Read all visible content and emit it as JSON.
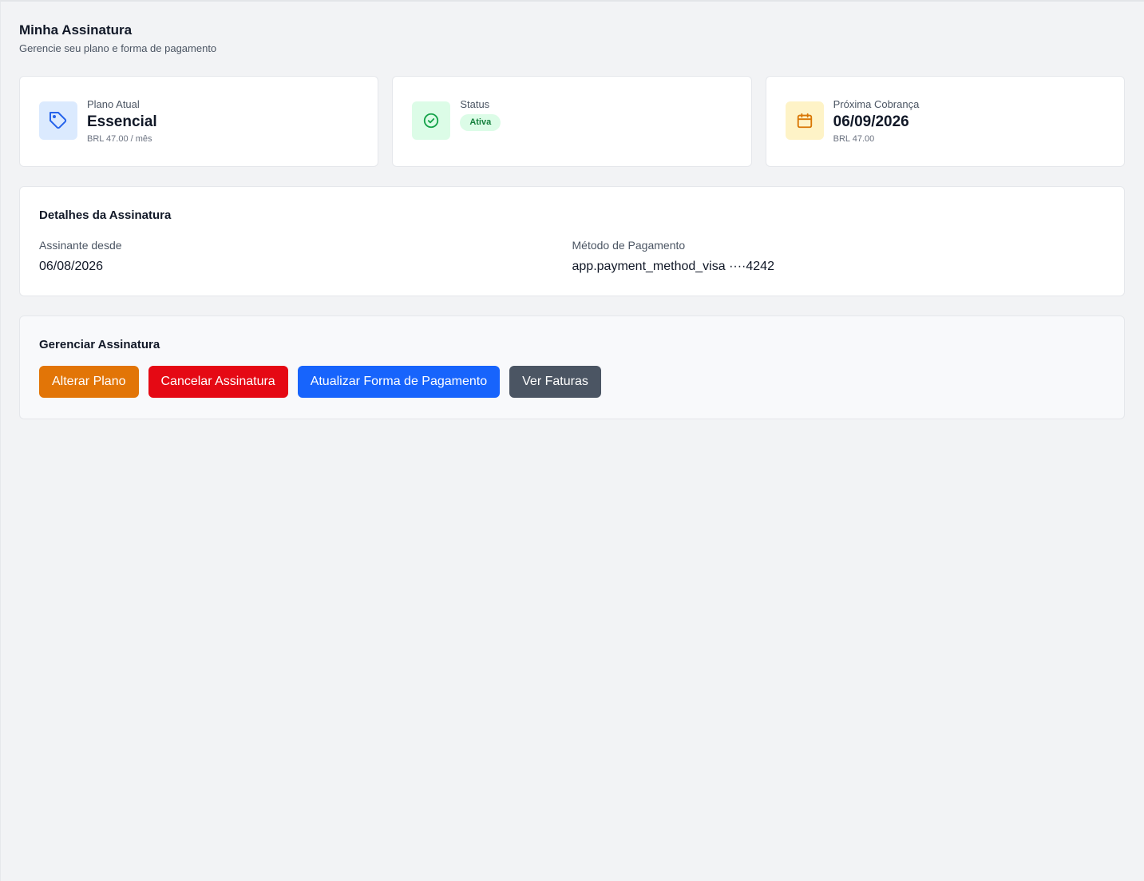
{
  "header": {
    "title": "Minha Assinatura",
    "subtitle": "Gerencie seu plano e forma de pagamento"
  },
  "cards": {
    "plan": {
      "icon": "tag-icon",
      "label": "Plano Atual",
      "value": "Essencial",
      "sub": "BRL 47.00 / mês"
    },
    "status": {
      "icon": "check-circle-icon",
      "label": "Status",
      "badge": "Ativa"
    },
    "next_charge": {
      "icon": "calendar-icon",
      "label": "Próxima Cobrança",
      "value": "06/09/2026",
      "sub": "BRL 47.00"
    }
  },
  "details": {
    "title": "Detalhes da Assinatura",
    "since_label": "Assinante desde",
    "since_value": "06/08/2026",
    "payment_label": "Método de Pagamento",
    "payment_value": "app.payment_method_visa ····4242"
  },
  "manage": {
    "title": "Gerenciar Assinatura",
    "buttons": {
      "change_plan": "Alterar Plano",
      "cancel": "Cancelar Assinatura",
      "update_payment": "Atualizar Forma de Pagamento",
      "invoices": "Ver Faturas"
    }
  },
  "colors": {
    "background": "#f2f3f5",
    "orange": "#e27507",
    "red": "#e50914",
    "blue": "#1764fc",
    "gray": "#4b5563",
    "success": "#15803d"
  }
}
